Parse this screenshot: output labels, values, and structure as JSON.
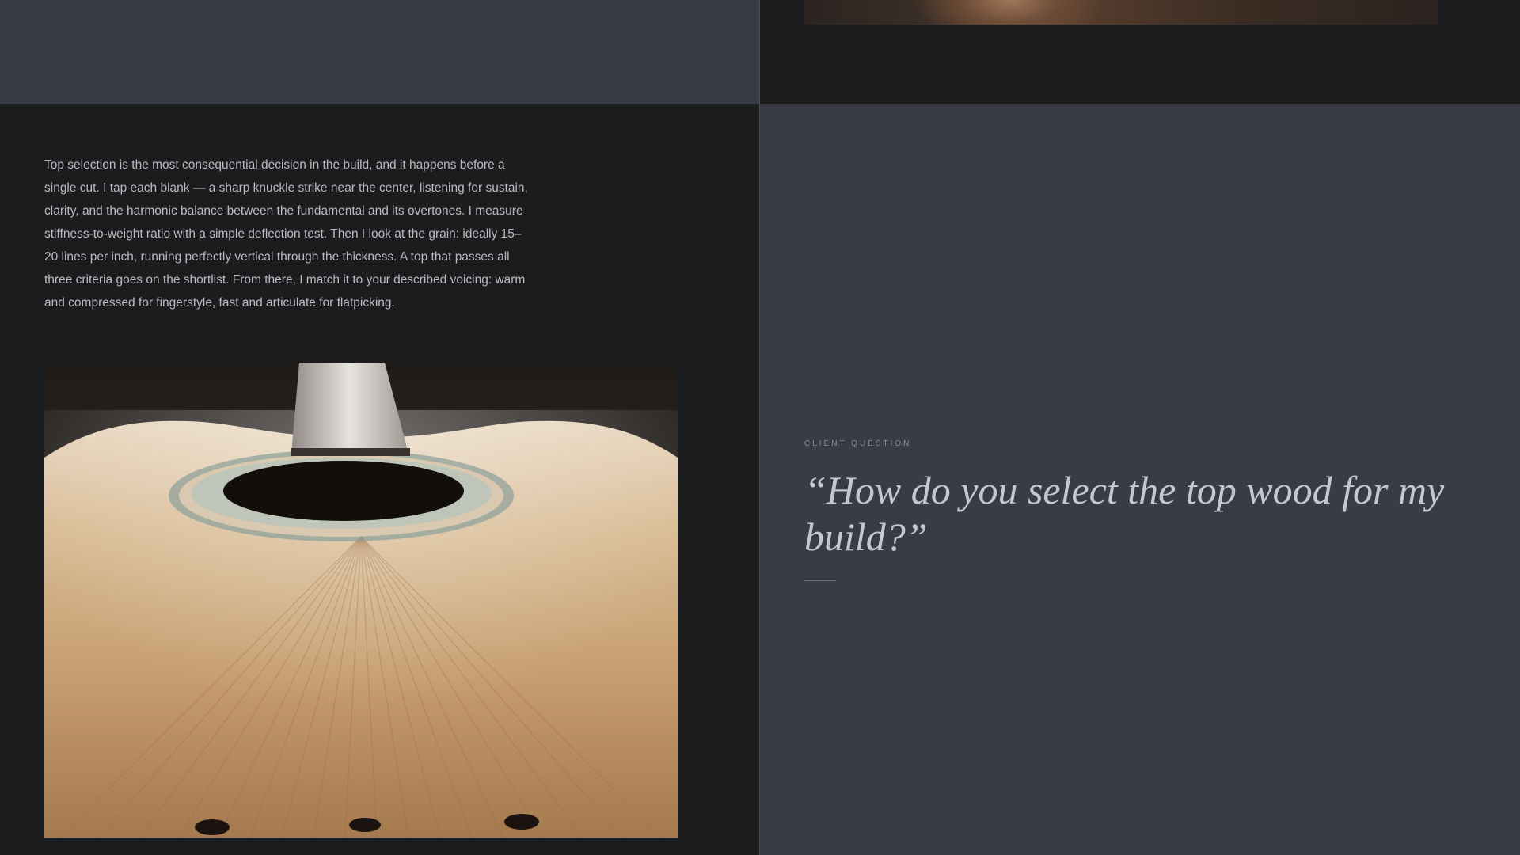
{
  "body": {
    "paragraph": "Top selection is the most consequential decision in the build, and it happens before a single cut. I tap each blank — a sharp knuckle strike near the center, listening for sustain, clarity, and the harmonic balance between the fundamental and its overtones. I measure stiffness-to-weight ratio with a simple deflection test. Then I look at the grain: ideally 15–20 lines per inch, running perfectly vertical through the thickness. A top that passes all three criteria goes on the shortlist. From there, I match it to your described voicing: warm and compressed for fingerstyle, fast and articulate for flatpicking."
  },
  "question": {
    "eyebrow": "Client Question",
    "text": "“How do you select the top wood for my build?”"
  },
  "colors": {
    "panel": "#3a3c45",
    "dark": "#1b1c1e",
    "text": "#b9bbc0",
    "quote": "#c6c8cf"
  },
  "icons": {
    "guitar_photo": "acoustic-guitar-top-photo",
    "top_photo": "luthier-hands-photo"
  }
}
